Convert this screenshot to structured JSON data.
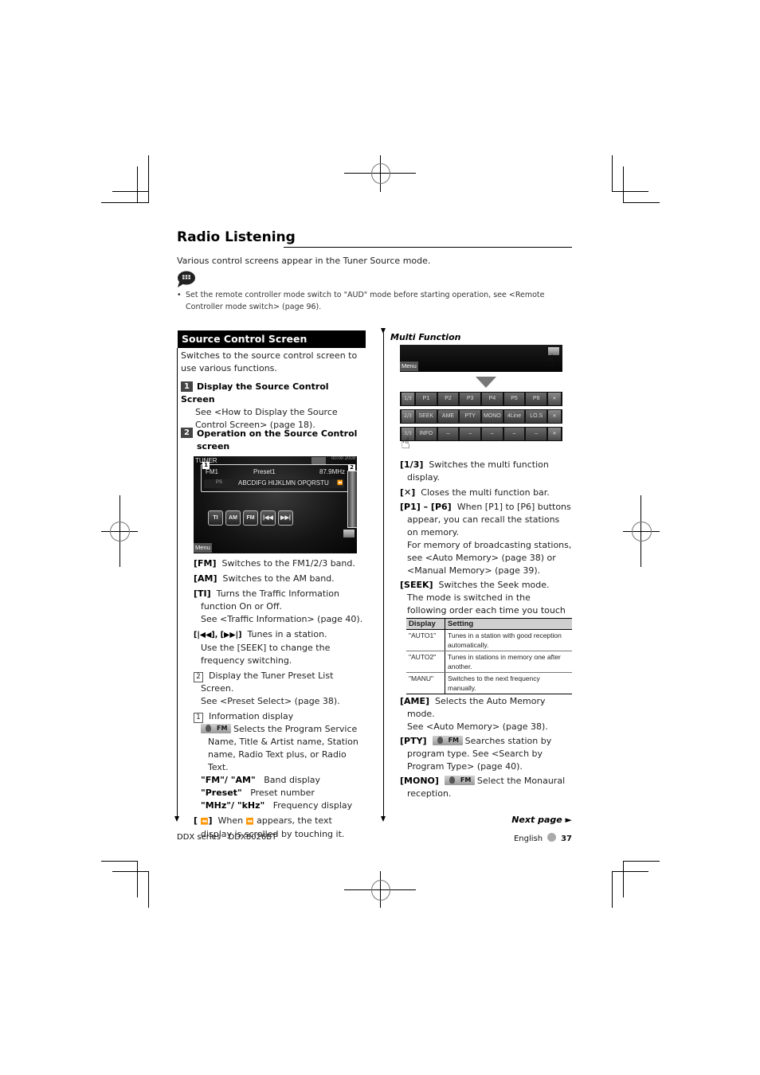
{
  "page": {
    "title": "Radio Listening",
    "intro": "Various control screens appear in the Tuner Source mode.",
    "note_icon": "note-speech-bubble-icon",
    "note": "Set the remote controller mode switch to \"AUD\" mode before starting operation, see <Remote Controller mode switch> (page 96)."
  },
  "left": {
    "section_title": "Source Control Screen",
    "section_desc": "Switches to the source control screen to use various functions.",
    "steps": [
      {
        "num": "1",
        "title": "Display the Source Control Screen",
        "desc": "See <How to Display the Source Control Screen> (page 18)."
      },
      {
        "num": "2",
        "title": "Operation on the Source Control screen"
      }
    ],
    "screen": {
      "source": "TUNER",
      "clock": "00:00 2009",
      "band": "FM1",
      "preset": "Preset1",
      "frequency": "87.9MHz",
      "ps_label": "PS",
      "radio_text": "ABCDIFG HIJKLMN OPQRSTU",
      "callout_1": "1",
      "callout_2": "2",
      "buttons": [
        "TI",
        "AM",
        "FM",
        "|◀◀",
        "▶▶|"
      ],
      "menu": "Menu"
    },
    "items": [
      {
        "key": "[FM]",
        "text": "Switches to the FM1/2/3 band."
      },
      {
        "key": "[AM]",
        "text": "Switches to the AM band."
      },
      {
        "key": "[TI]",
        "text": "Turns the Traffic Information function On or Off.",
        "sub": "See <Traffic Information> (page 40)."
      },
      {
        "key": "[|◀◀], [▶▶|]",
        "text": "Tunes in a station.",
        "sub": "Use the [SEEK] to change the frequency switching."
      }
    ],
    "box2": {
      "num": "2",
      "text": "Display the Tuner Preset List Screen.",
      "sub": "See <Preset Select> (page 38)."
    },
    "box1": {
      "num": "1",
      "text": "Information display"
    },
    "fm_icon_label": "FM",
    "fm_icon_text": "Selects the Program Service Name, Title & Artist name, Station name, Radio Text plus, or Radio Text.",
    "defs": [
      {
        "key": "\"FM\"/ \"AM\"",
        "text": "Band display"
      },
      {
        "key": "\"Preset\"",
        "text": "Preset number"
      },
      {
        "key": "\"MHz\"/ \"kHz\"",
        "text": "Frequency display"
      }
    ],
    "scroll_item": {
      "key_open": "[",
      "key_close": "]",
      "text_a": "When",
      "text_b": "appears, the text display is scrolled by touching it."
    }
  },
  "right": {
    "heading": "Multi Function",
    "top_screen_menu": "Menu",
    "bars": [
      [
        "1/3",
        "P1",
        "P2",
        "P3",
        "P4",
        "P5",
        "P6",
        "✕"
      ],
      [
        "2/3",
        "SEEK",
        "AME",
        "PTY",
        "MONO",
        "4Line",
        "LO.S",
        "✕"
      ],
      [
        "3/3",
        "INFO",
        "–",
        "–",
        "–",
        "–",
        "–",
        "✕"
      ]
    ],
    "items": [
      {
        "key": "[1/3]",
        "text": "Switches the multi function display."
      },
      {
        "key": "[✕]",
        "text": "Closes the multi function bar."
      },
      {
        "key": "[P1] – [P6]",
        "text": "When [P1] to [P6] buttons appear, you can recall the stations on memory.",
        "sub": "For memory of broadcasting stations, see <Auto Memory> (page 38) or <Manual Memory> (page 39)."
      },
      {
        "key": "[SEEK]",
        "text": "Switches the Seek mode.",
        "sub": "The mode is switched in the following order each time you touch the button."
      }
    ],
    "table": {
      "headers": [
        "Display",
        "Setting"
      ],
      "rows": [
        [
          "\"AUTO1\"",
          "Tunes in a station with good reception automatically."
        ],
        [
          "\"AUTO2\"",
          "Tunes in stations in memory one after another."
        ],
        [
          "\"MANU\"",
          "Switches to the next frequency manually."
        ]
      ]
    },
    "items2": [
      {
        "key": "[AME]",
        "text": "Selects the Auto Memory mode.",
        "sub": "See <Auto Memory> (page 38)."
      },
      {
        "key": "[PTY]",
        "text": "Searches station by program type. See <Search by Program Type> (page 40)."
      },
      {
        "key": "[MONO]",
        "text": "Select the Monaural reception."
      }
    ],
    "next_page": "Next page ►"
  },
  "footer": {
    "left": "DDX series   DDX8026BT",
    "lang": "English",
    "page_num": "37"
  }
}
